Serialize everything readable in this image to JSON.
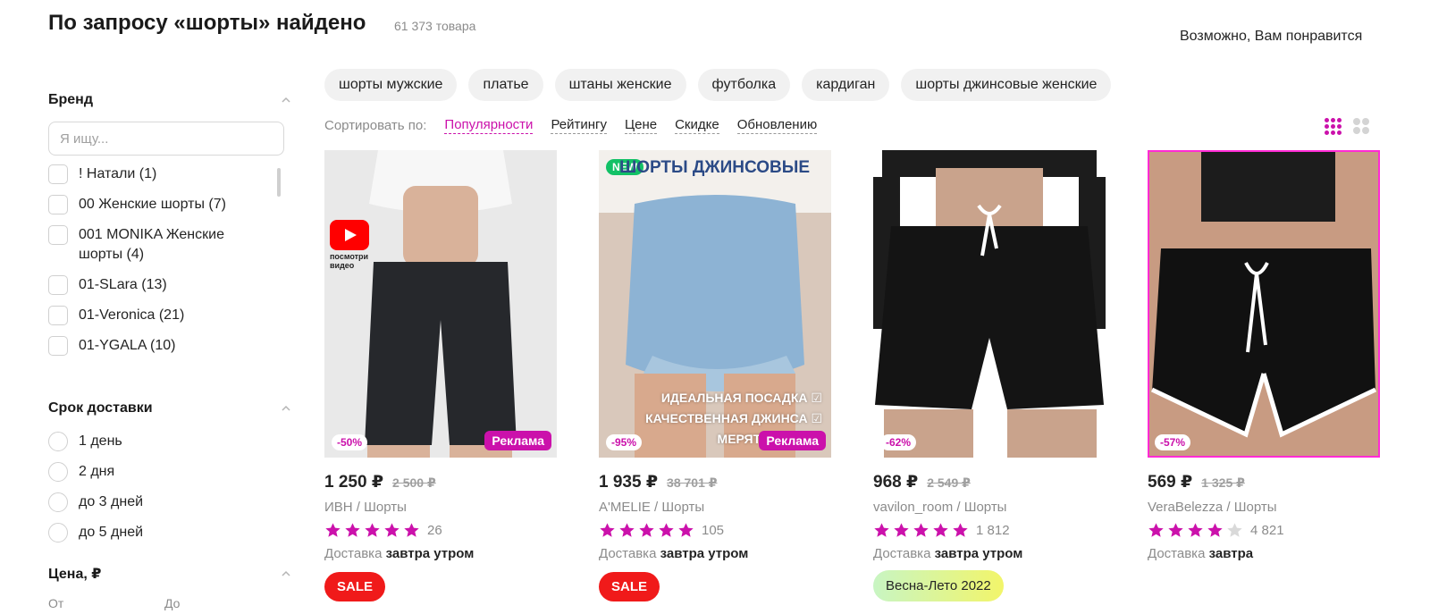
{
  "header": {
    "title": "По запросу «шорты» найдено",
    "count": "61 373 товара",
    "maybe_like": "Возможно, Вам понравится"
  },
  "sidebar": {
    "brand": {
      "title": "Бренд",
      "search_placeholder": "Я ищу...",
      "items": [
        "! Натали (1)",
        "00 Женские шорты (7)",
        "001 MONIKA Женские шорты (4)",
        "01-SLara (13)",
        "01-Veronica (21)",
        "01-YGALA (10)"
      ]
    },
    "delivery": {
      "title": "Срок доставки",
      "items": [
        "1 день",
        "2 дня",
        "до 3 дней",
        "до 5 дней"
      ]
    },
    "price": {
      "title": "Цена, ₽",
      "from": "От",
      "to": "До"
    }
  },
  "tags": [
    "шорты мужские",
    "платье",
    "штаны женские",
    "футболка",
    "кардиган",
    "шорты джинсовые женские"
  ],
  "sort": {
    "label": "Сортировать по:",
    "options": [
      "Популярности",
      "Рейтингу",
      "Цене",
      "Скидке",
      "Обновлению"
    ],
    "active": "Популярности"
  },
  "products": [
    {
      "price": "1 250 ₽",
      "old_price": "2 500 ₽",
      "brand": "ИВН / Шорты",
      "rating_count": "26",
      "rating_stars": 5,
      "delivery_prefix": "Доставка",
      "delivery_when": "завтра утром",
      "discount": "-50%",
      "ad": "Реклама",
      "badge": "SALE",
      "video_caption": "посмотри видео"
    },
    {
      "price": "1 935 ₽",
      "old_price": "38 701 ₽",
      "brand": "A'MELIE / Шорты",
      "rating_count": "105",
      "rating_stars": 5,
      "delivery_prefix": "Доставка",
      "delivery_when": "завтра утром",
      "discount": "-95%",
      "ad": "Реклама",
      "badge": "SALE",
      "new": "NEW",
      "img_title": "ШОРТЫ ДЖИНСОВЫЕ",
      "img_lines": [
        "ИДЕАЛЬНАЯ ПОСАДКА ☑",
        "КАЧЕСТВЕННАЯ ДЖИНСА ☑",
        "МЕРЯТ НА ОДИН"
      ]
    },
    {
      "price": "968 ₽",
      "old_price": "2 549 ₽",
      "brand": "vavilon_room / Шорты",
      "rating_count": "1 812",
      "rating_stars": 5,
      "delivery_prefix": "Доставка",
      "delivery_when": "завтра утром",
      "discount": "-62%",
      "badge": "Весна-Лето 2022"
    },
    {
      "price": "569 ₽",
      "old_price": "1 325 ₽",
      "brand": "VeraBelezza / Шорты",
      "rating_count": "4 821",
      "rating_stars": 4,
      "delivery_prefix": "Доставка",
      "delivery_when": "завтра",
      "discount": "-57%"
    }
  ],
  "colors": {
    "accent": "#cb11ab",
    "sale": "#f01a1a",
    "star_empty": "#d9d9d9"
  }
}
